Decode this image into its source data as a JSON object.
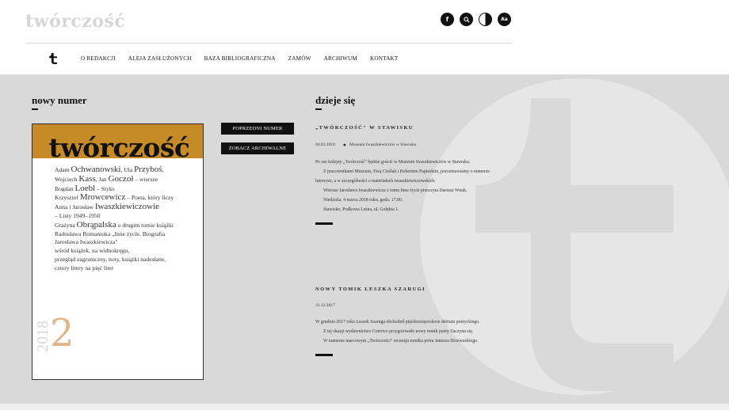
{
  "header": {
    "logo": "twórczość",
    "icons": [
      {
        "name": "facebook-icon",
        "glyph": "f"
      },
      {
        "name": "search-icon",
        "glyph": "⚲"
      },
      {
        "name": "contrast-icon",
        "glyph": ""
      },
      {
        "name": "font-size-icon",
        "glyph": "Aa"
      }
    ]
  },
  "nav": {
    "items": [
      "O REDAKCJI",
      "ALEJA ZASŁUŻONYCH",
      "BAZA BIBLIOGRAFICZNA",
      "ZAMÓW",
      "ARCHIWUM",
      "KONTAKT"
    ]
  },
  "left": {
    "heading": "nowy numer",
    "cover": {
      "title": "twórczość",
      "year": "2018",
      "number": "2",
      "lines": [
        {
          "small": "Adam ",
          "big": "Ochwanowski",
          "rest_small": ", Ula ",
          "big2": "Przyboś",
          "tail": ","
        },
        {
          "small": "Wojciech ",
          "big": "Kass",
          "rest_small": ", Jan ",
          "big2": "Goczoł",
          "tail": " – wiersze"
        },
        {
          "small": "Bogdan ",
          "big": "Loebl",
          "rest_small": " – Styks",
          "big2": "",
          "tail": ""
        },
        {
          "small": "Krzysztof ",
          "big": "Mrowcewicz",
          "rest_small": " – Poeta, który liczy",
          "big2": "",
          "tail": ""
        },
        {
          "small": "Anna i Jarosław ",
          "big": "Iwaszkiewiczowie",
          "rest_small": "",
          "big2": "",
          "tail": ""
        },
        {
          "small": "– Listy 1949–1950",
          "big": "",
          "rest_small": "",
          "big2": "",
          "tail": ""
        },
        {
          "small": "Grażyna ",
          "big": "Obrąpalska",
          "rest_small": " o drugim tomie książki",
          "big2": "",
          "tail": ""
        },
        {
          "small": "Radosława Romaniuka „Inne życie. Biografia",
          "big": "",
          "rest_small": "",
          "big2": "",
          "tail": ""
        },
        {
          "small": "Jarosława Iwaszkiewicza\"",
          "big": "",
          "rest_small": "",
          "big2": "",
          "tail": ""
        },
        {
          "small": "wśród książek, na widnokręgu,",
          "big": "",
          "rest_small": "",
          "big2": "",
          "tail": ""
        },
        {
          "small": "przegląd zagraniczny, noty, książki nadesłane,",
          "big": "",
          "rest_small": "",
          "big2": "",
          "tail": ""
        },
        {
          "small": "cztery litery na pięć liter",
          "big": "",
          "rest_small": "",
          "big2": "",
          "tail": ""
        }
      ]
    },
    "buttons": {
      "prev": "POPRZEDNI NUMER",
      "archive": "ZOBACZ ARCHIWALNE"
    }
  },
  "right": {
    "heading": "dzieje się",
    "news": [
      {
        "title": "„TWÓRCZOŚĆ\" W STAWISKU",
        "date": "04.03.2018",
        "location": "Muzeum Iwaszkiewiczów w Stawisku",
        "paragraphs": [
          {
            "text": "Po raz kolejny „Twórczość\" będzie gościć w Muzeum Iwaszkiewiczów w Stawisku.",
            "indent": false
          },
          {
            "text": "Z pracownikami Muzeum, Ewą Cieślak i Robertem Papieskim, porozmawiamy o numerze lutowym, a w szczególności o materiałach iwaszkiewiczowskich.",
            "indent": true
          },
          {
            "text": "Wiersze Jarosława Iwaszkiewicza z tomu Inne życie przeczyta Dariusz Wnuk.",
            "indent": true
          },
          {
            "text": "Niedziela, 4 marca 2018 roku, godz. 17.00.",
            "indent": true
          },
          {
            "text": "Stawisko, Podkowa Leśna, ul. Gołębia 1.",
            "indent": true
          }
        ]
      },
      {
        "title": "NOWY TOMIK LESZKA SZARUGI",
        "date": "31.12.2017",
        "location": "",
        "paragraphs": [
          {
            "text": "W grudniu 2017 roku Leszek Szaruga obchodził pięćdziesięciolecie debiutu poetyckiego.",
            "indent": false
          },
          {
            "text": "Z tej okazji wydawnictwo Convivo przygotowało nowy tomik poety Zaczyna się.",
            "indent": true
          },
          {
            "text": "W numerze marcowym „Twórczości\" recenzja tomiku pióra Janusza Drzewuckiego.",
            "indent": true
          }
        ]
      }
    ]
  },
  "colors": {
    "band": "#d9d9d9",
    "cover_band": "#c68a26",
    "cover_number": "#e2b48a",
    "logo": "#d6d6d6"
  }
}
